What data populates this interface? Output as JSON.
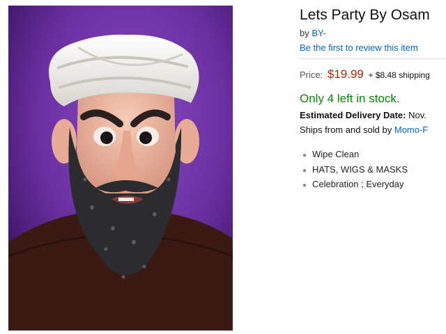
{
  "product": {
    "title": "Lets Party By Osam",
    "by_label": "by",
    "brand": "BY-",
    "review_link": "Be the first to review this item",
    "price_label": "Price:",
    "price": "$19.99",
    "shipping": "+ $8.48 shipping",
    "stock": "Only 4 left in stock.",
    "delivery_label": "Estimated Delivery Date:",
    "delivery_value": "Nov.",
    "ships_text": "Ships from and sold by",
    "seller": "Momo-F",
    "bullets": [
      "Wipe Clean",
      "HATS, WIGS & MASKS",
      "Celebration ; Everyday"
    ]
  },
  "image": {
    "icon": "party-mask-image",
    "colors": {
      "background": "#6a2fa0",
      "turban": "#f2f0ec",
      "skin": "#f0b8a2",
      "beard": "#2b2b30",
      "sweater": "#3a1a12"
    }
  },
  "colors": {
    "link": "#0066c0",
    "price": "#b12704",
    "stock": "#008a00"
  }
}
